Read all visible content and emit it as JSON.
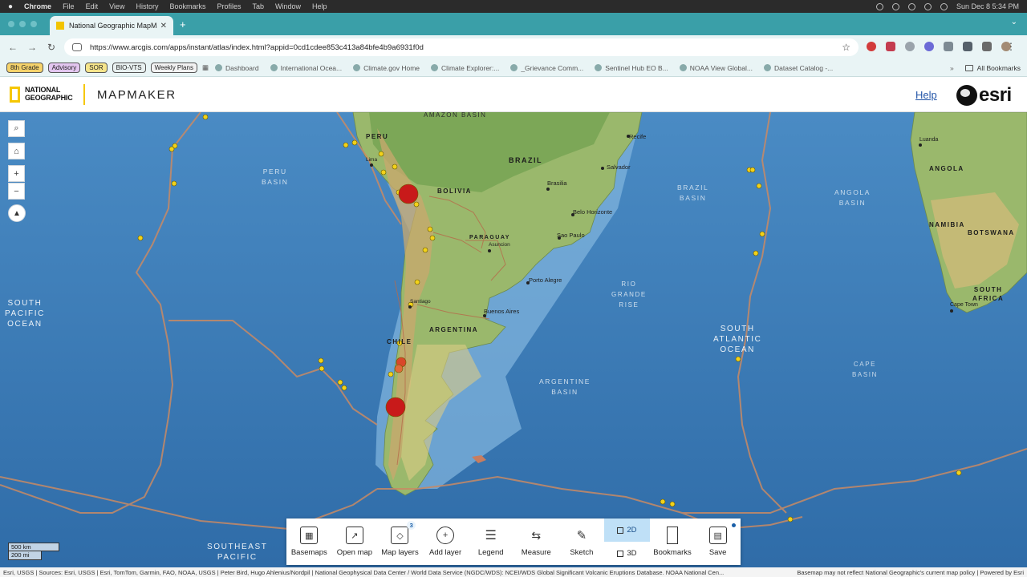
{
  "menubar": {
    "app": "Chrome",
    "items": [
      "File",
      "Edit",
      "View",
      "History",
      "Bookmarks",
      "Profiles",
      "Tab",
      "Window",
      "Help"
    ],
    "datetime": "Sun Dec 8  5:34 PM"
  },
  "browser": {
    "tab_title": "National Geographic MapMak",
    "url": "https://www.arcgis.com/apps/instant/atlas/index.html?appid=0cd1cdee853c413a84bfe4b9a6931f0d",
    "bookmark_pills": [
      "8th Grade",
      "Advisory",
      "SOR",
      "BIO-VTS",
      "Weekly Plans"
    ],
    "bookmarks": [
      "Dashboard",
      "International Ocea...",
      "Climate.gov Home",
      "Climate Explorer:...",
      "_Grievance Comm...",
      "Sentinel Hub EO B...",
      "NOAA View Global...",
      "Dataset Catalog -..."
    ],
    "all_bookmarks": "All Bookmarks"
  },
  "app": {
    "brand_line1": "NATIONAL",
    "brand_line2": "GEOGRAPHIC",
    "product": "MAPMAKER",
    "help": "Help",
    "esri": "esri"
  },
  "map": {
    "countries": [
      {
        "name": "BRAZIL"
      },
      {
        "name": "BOLIVIA"
      },
      {
        "name": "PARAGUAY"
      },
      {
        "name": "ARGENTINA"
      },
      {
        "name": "CHILE"
      },
      {
        "name": "PERU"
      },
      {
        "name": "ANGOLA"
      },
      {
        "name": "NAMIBIA"
      },
      {
        "name": "BOTSWANA"
      }
    ],
    "south_africa": [
      "SOUTH",
      "AFRICA"
    ],
    "oceans": {
      "south_pacific": [
        "SOUTH",
        "PACIFIC",
        "OCEAN"
      ],
      "south_atlantic": [
        "SOUTH",
        "ATLANTIC",
        "OCEAN"
      ],
      "southeast_pacific": [
        "SOUTHEAST",
        "PACIFIC"
      ],
      "peru_basin": [
        "PERU",
        "BASIN"
      ],
      "argentine_basin": [
        "ARGENTINE",
        "BASIN"
      ],
      "rio_grande_rise": [
        "RIO",
        "GRANDE",
        "RISE"
      ],
      "brazil_basin": [
        "BRAZIL",
        "BASIN"
      ],
      "angola_basin": [
        "ANGOLA",
        "BASIN"
      ],
      "cape_basin": [
        "CAPE",
        "BASIN"
      ],
      "amazon_basin": "AMAZON BASIN"
    },
    "cities": [
      "Recife",
      "Salvador",
      "Brasilia",
      "Belo Horizonte",
      "Sao Paulo",
      "Asuncion",
      "Porto Alegre",
      "Buenos Aires",
      "Santiago",
      "Lima",
      "Luanda",
      "Cape Town"
    ],
    "scale": [
      "500 km",
      "200 mi"
    ]
  },
  "toolbar": {
    "buttons": [
      {
        "label": "Basemaps"
      },
      {
        "label": "Open map"
      },
      {
        "label": "Map layers",
        "badge": "3"
      },
      {
        "label": "Add layer"
      },
      {
        "label": "Legend"
      },
      {
        "label": "Measure"
      },
      {
        "label": "Sketch"
      },
      {
        "label": "Bookmarks"
      },
      {
        "label": "Save"
      }
    ],
    "dim_2d": "2D",
    "dim_3d": "3D"
  },
  "attribution": {
    "left": "Esri, USGS | Sources: Esri, USGS | Esri, TomTom, Garmin, FAO, NOAA, USGS | Peter Bird, Hugo Ahlenius/Nordpil | National Geophysical Data Center / World Data Service (NGDC/WDS): NCEI/WDS Global Significant Volcanic Eruptions Database. NOAA National Cen...",
    "right": "Basemap may not reflect National Geographic's current map policy | Powered by Esri"
  },
  "colors": {
    "tabstrip": "#3a9fa8",
    "ocean": "#3f7fb9",
    "land": "#8fb56a",
    "volcano_small": "#f2d21a",
    "volcano_large": "#c81a1a"
  }
}
